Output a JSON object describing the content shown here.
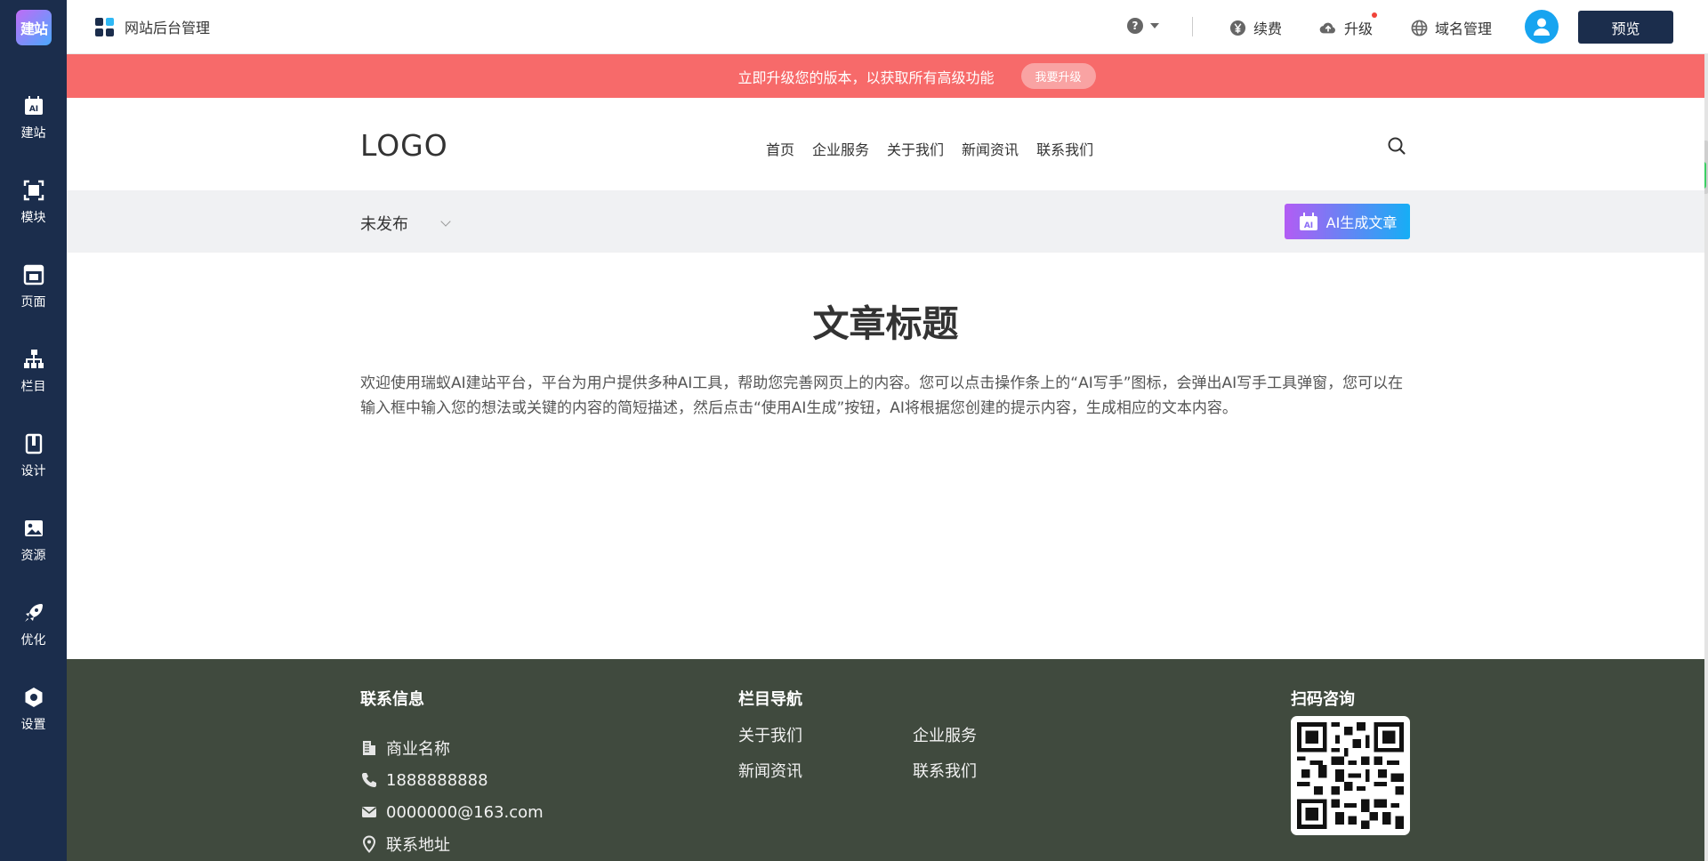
{
  "app": {
    "rail_logo": "建站",
    "title": "网站后台管理"
  },
  "rail": {
    "items": [
      {
        "label": "建站",
        "icon": "ai-site-icon"
      },
      {
        "label": "模块",
        "icon": "module-icon"
      },
      {
        "label": "页面",
        "icon": "page-icon"
      },
      {
        "label": "栏目",
        "icon": "sitemap-icon"
      },
      {
        "label": "设计",
        "icon": "design-icon"
      },
      {
        "label": "资源",
        "icon": "image-resource-icon"
      },
      {
        "label": "优化",
        "icon": "rocket-icon"
      },
      {
        "label": "设置",
        "icon": "settings-icon"
      }
    ]
  },
  "topbar": {
    "help_symbol": "?",
    "renew": "续费",
    "upgrade": "升级",
    "domain": "域名管理",
    "preview": "预览"
  },
  "banner": {
    "text": "立即升级您的版本，以获取所有高级功能",
    "button": "我要升级"
  },
  "site": {
    "logo": "LOGO",
    "nav": [
      "首页",
      "企业服务",
      "关于我们",
      "新闻资讯",
      "联系我们"
    ]
  },
  "filter": {
    "status": "未发布",
    "ai_button": "AI生成文章",
    "ai_badge": "AI"
  },
  "article": {
    "title": "文章标题",
    "body": "欢迎使用瑞蚁AI建站平台，平台为用户提供多种AI工具，帮助您完善网页上的内容。您可以点击操作条上的“AI写手”图标，会弹出AI写手工具弹窗，您可以在输入框中输入您的想法或关键的内容的简短描述，然后点击“使用AI生成”按钮，AI将根据您创建的提示内容，生成相应的文本内容。"
  },
  "footer": {
    "contact_title": "联系信息",
    "company": "商业名称",
    "phone": "1888888888",
    "email": "0000000@163.com",
    "address": "联系地址",
    "nav_title": "栏目导航",
    "nav": [
      "关于我们",
      "企业服务",
      "新闻资讯",
      "联系我们"
    ],
    "qr_title": "扫码咨询"
  },
  "colors": {
    "rail": "#1b2d4c",
    "banner": "#f76a6a",
    "footer": "#404a3e",
    "accent": "#17a4f0"
  }
}
